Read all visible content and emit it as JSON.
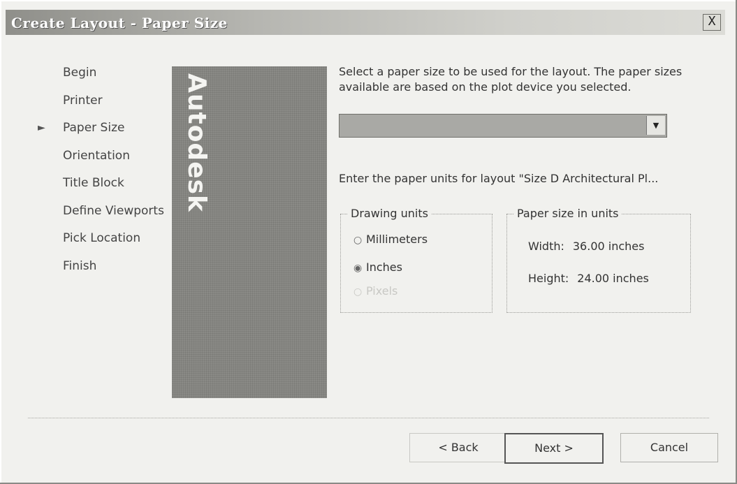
{
  "window": {
    "title": "Create Layout - Paper Size",
    "close_glyph": "X"
  },
  "steps": [
    {
      "label": "Begin",
      "active": false
    },
    {
      "label": "Printer",
      "active": false
    },
    {
      "label": "Paper Size",
      "active": true
    },
    {
      "label": "Orientation",
      "active": false
    },
    {
      "label": "Title Block",
      "active": false
    },
    {
      "label": "Define Viewports",
      "active": false
    },
    {
      "label": "Pick Location",
      "active": false
    },
    {
      "label": "Finish",
      "active": false
    }
  ],
  "banner": {
    "logo_text": "Autodesk"
  },
  "main": {
    "instruction": "Select a paper size to be used for the layout. The paper sizes available are based on the plot device you selected.",
    "paper_size_value": "",
    "units_prompt": "Enter the paper units for layout \"Size D Architectural Pl...",
    "drawing_units": {
      "legend": "Drawing units",
      "options": [
        {
          "label": "Millimeters",
          "selected": false,
          "disabled": false
        },
        {
          "label": "Inches",
          "selected": true,
          "disabled": false
        },
        {
          "label": "Pixels",
          "selected": false,
          "disabled": true
        }
      ]
    },
    "paper_units": {
      "legend": "Paper size in units",
      "width_label": "Width:",
      "width_value": "36.00 inches",
      "height_label": "Height:",
      "height_value": "24.00 inches"
    }
  },
  "buttons": {
    "back": "< Back",
    "next": "Next >",
    "cancel": "Cancel"
  }
}
